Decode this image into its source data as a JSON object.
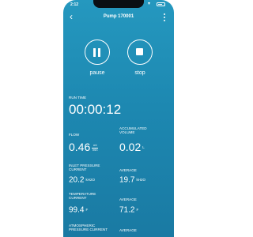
{
  "status_bar": {
    "time": "2:12"
  },
  "app_bar": {
    "title": "Pump 170001",
    "back_icon": "back-arrow-icon",
    "menu_icon": "more-vertical-icon"
  },
  "controls": {
    "pause": {
      "label": "pause",
      "icon": "pause-icon"
    },
    "stop": {
      "label": "stop",
      "icon": "stop-icon"
    }
  },
  "run_time": {
    "label": "RUN TIME",
    "value": "00:00:12"
  },
  "flow": {
    "label": "FLOW",
    "value": "0.46",
    "unit_top": "ml",
    "unit_bottom": "min"
  },
  "accumulated_volume": {
    "label": "ACCUMULATED VOLUME",
    "value": "0.02",
    "unit": "L"
  },
  "inlet_pressure": {
    "label": "INLET PRESSURE CURRENT",
    "value": "20.2",
    "unit": "kH2O"
  },
  "inlet_pressure_average": {
    "label": "AVERAGE",
    "value": "19.7",
    "unit": "kH2O"
  },
  "temperature": {
    "label": "TEMPERATURE CURRENT",
    "value": "99.4",
    "unit": "F"
  },
  "temperature_average": {
    "label": "AVERAGE",
    "value": "71.2",
    "unit": "F"
  },
  "atmospheric_pressure": {
    "label": "ATMOSPHERIC PRESSURE CURRENT"
  },
  "atmospheric_pressure_average": {
    "label": "AVERAGE"
  },
  "colors": {
    "background_top": "#2598bf",
    "background_bottom": "#1a7aa3",
    "text": "#ffffff"
  }
}
